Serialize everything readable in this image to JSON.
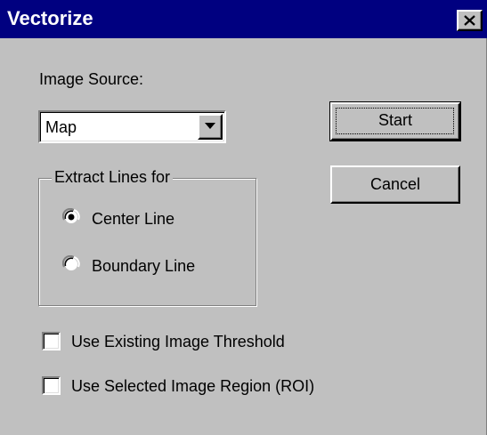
{
  "window": {
    "title": "Vectorize",
    "close_icon": "close-icon"
  },
  "image_source": {
    "label": "Image Source:",
    "selected": "Map"
  },
  "buttons": {
    "start": "Start",
    "cancel": "Cancel"
  },
  "extract_group": {
    "legend": "Extract Lines for",
    "options": [
      {
        "label": "Center Line",
        "selected": true
      },
      {
        "label": "Boundary Line",
        "selected": false
      }
    ]
  },
  "checkboxes": [
    {
      "label": "Use Existing Image Threshold",
      "checked": false
    },
    {
      "label": "Use Selected Image Region (ROI)",
      "checked": false
    }
  ],
  "colors": {
    "title_bar": "#000080",
    "face": "#c0c0c0"
  }
}
